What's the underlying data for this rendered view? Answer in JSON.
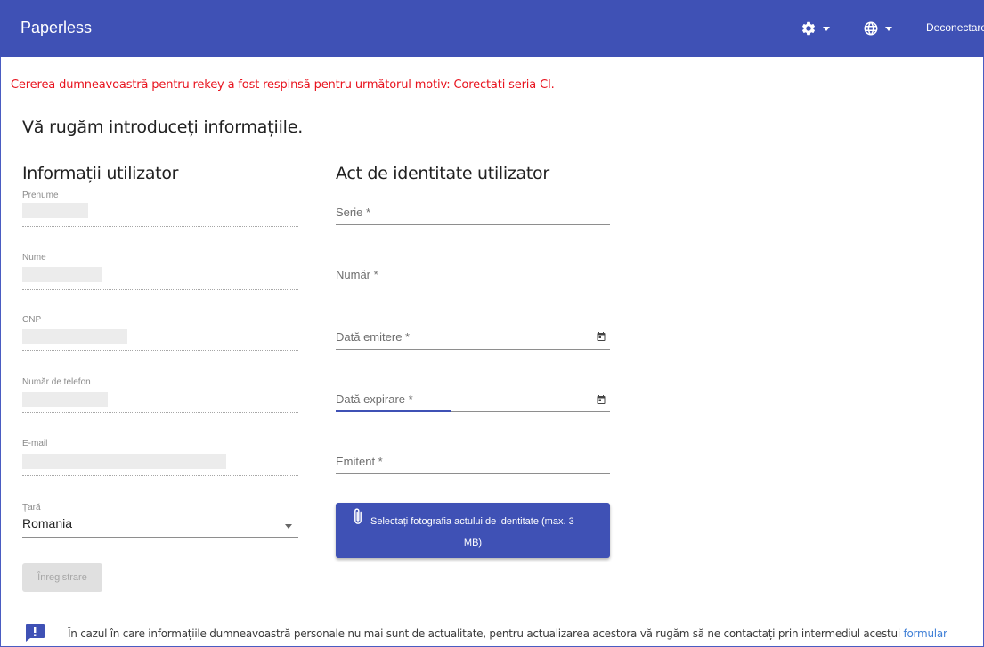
{
  "header": {
    "title": "Paperless",
    "settings_icon": "gear-icon",
    "language_icon": "globe-icon",
    "logout_label": "Deconectare"
  },
  "error_message": "Cererea dumneavoastră pentru rekey a fost respinsă pentru următorul motiv: Corectati seria CI.",
  "page_title": "Vă rugăm introduceți informațiile.",
  "user_info": {
    "title": "Informații utilizator",
    "fields": [
      {
        "label": "Prenume",
        "value": ""
      },
      {
        "label": "Nume",
        "value": ""
      },
      {
        "label": "CNP",
        "value": ""
      },
      {
        "label": "Număr de telefon",
        "value": ""
      },
      {
        "label": "E-mail",
        "value": ""
      }
    ],
    "country": {
      "label": "Țară",
      "value": "Romania"
    }
  },
  "id_card": {
    "title": "Act de identitate utilizator",
    "fields": [
      {
        "label": "Serie *",
        "value": ""
      },
      {
        "label": "Număr *",
        "value": ""
      },
      {
        "label": "Dată emitere *",
        "value": "",
        "icon": "calendar-icon"
      },
      {
        "label": "Dată expirare *",
        "value": "",
        "icon": "calendar-icon"
      },
      {
        "label": "Emitent *",
        "value": ""
      }
    ],
    "upload_label_line1": "Selectați fotografia actului de identitate (max. 3",
    "upload_label_line2": "MB)",
    "upload_icon": "paperclip-icon"
  },
  "register_label": "Înregistrare",
  "info_notice": {
    "icon": "feedback-icon",
    "text": "În cazul în care informațiile dumneavoastră personale nu mai sunt de actualitate, pentru actualizarea acestora vă rugăm să ne contactați prin intermediul acestui ",
    "link_text": "formular"
  },
  "colors": {
    "primary": "#3f51b5",
    "error": "#e8131e",
    "link": "#3f7fd6"
  }
}
